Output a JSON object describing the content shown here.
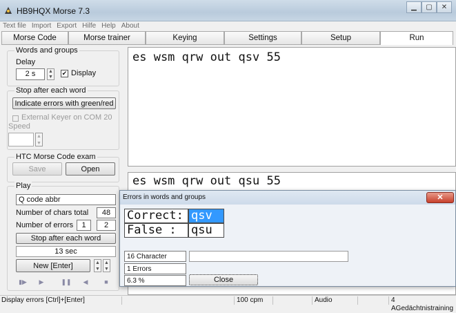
{
  "window": {
    "title": "HB9HQX Morse 7.3"
  },
  "menu": [
    "Text file",
    "Import",
    "Export",
    "Hilfe",
    "Help",
    "About"
  ],
  "tabs": [
    "Morse Code",
    "Morse trainer",
    "Keying",
    "Settings",
    "Setup",
    "Run"
  ],
  "active_tab": "Run",
  "words_groups": {
    "legend": "Words and groups",
    "delay_label": "Delay",
    "delay_value": "2 s",
    "display_checkbox": "Display",
    "display_checked": true
  },
  "stop_after_each_word": {
    "legend": "Stop after each word",
    "indicate_button": "Indicate errors with green/red",
    "external_keyer": "External Keyer on COM 20",
    "speed_label": "Speed",
    "speed_value": ""
  },
  "htc_exam": {
    "legend": "HTC Morse Code exam",
    "save_button": "Save",
    "open_button": "Open"
  },
  "play": {
    "legend": "Play",
    "mode_value": "Q code abbr",
    "chars_total_label": "Number of chars total",
    "chars_total_value": "48",
    "errors_label": "Number of errors",
    "errors_value_1": "1",
    "errors_value_2": "2",
    "stop_button": "Stop after each word",
    "time_value": "13 sec",
    "new_button": "New  [Enter]"
  },
  "main_text": {
    "expected": "es wsm qrw out qsv 55",
    "typed": "es wsm qrw out qsu 55"
  },
  "error_dialog": {
    "title": "Errors in words and groups",
    "correct_label": "Correct:",
    "correct_value": "qsv",
    "false_label": "False  :",
    "false_value": "qsu",
    "characters": "16 Character",
    "errors": "1 Errors",
    "percent": "6.3 %",
    "close_button": "Close"
  },
  "status": {
    "hint": "Display errors  [Ctrl]+[Enter]",
    "speed": "100 cpm",
    "audio": "Audio",
    "mode": "4 AGedächtnistraining"
  },
  "colors": {
    "selection": "#3399ff",
    "close_red": "#c7402c"
  }
}
